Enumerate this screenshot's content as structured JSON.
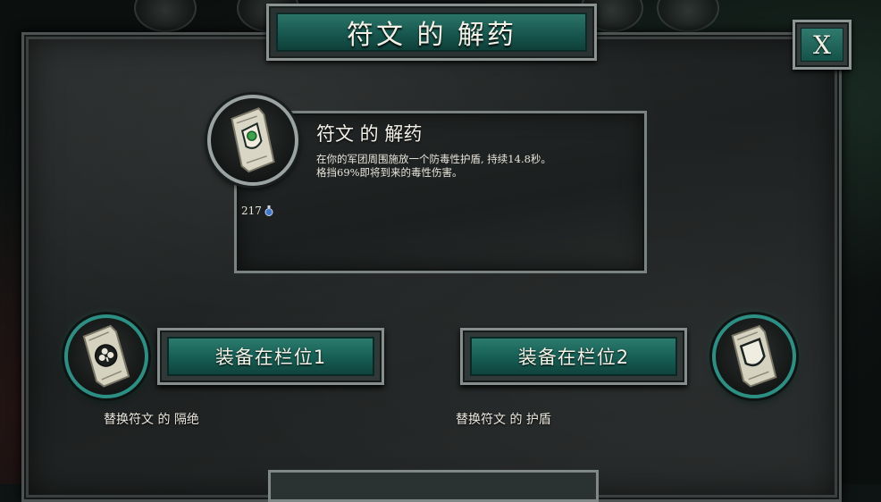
{
  "window": {
    "title": "符文 的 解药",
    "close_label": "X"
  },
  "selected_rune": {
    "name": "符文 的 解药",
    "description_lines": [
      "在你的军团周围施放一个防毒性护盾, 持续14.8秒。",
      "格挡69%即将到来的毒性伤害。"
    ],
    "cost": "217",
    "cost_icon": "potion-icon",
    "icon": "rune-tablet-green-gem-icon"
  },
  "slots": [
    {
      "button_label": "装备在栏位1",
      "replace_text": "替换符文 的 隔绝",
      "icon": "rune-tablet-clover-icon"
    },
    {
      "button_label": "装备在栏位2",
      "replace_text": "替换符文 的 护盾",
      "icon": "rune-tablet-shield-icon"
    }
  ],
  "colors": {
    "accent_teal": "#17574f",
    "slot_ring": "#2c8f83",
    "frame": "#868f8e"
  }
}
